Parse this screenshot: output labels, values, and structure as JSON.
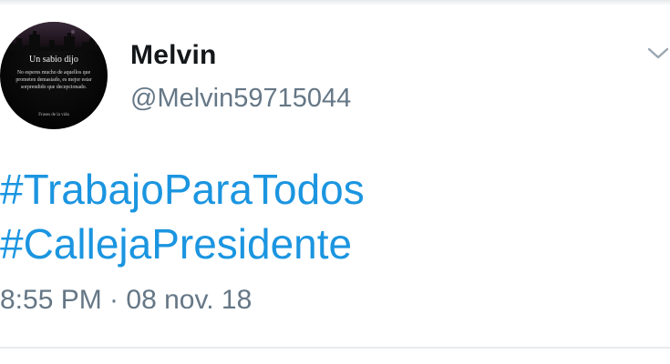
{
  "profile": {
    "display_name": "Melvin",
    "handle": "@Melvin59715044",
    "avatar": {
      "title": "Un sabio dijo",
      "quote": "No esperes mucho de aquellos que prometen demasiado, es mejor estar sorprendido que decepcionado.",
      "footer": "Frases de la vida"
    }
  },
  "tweet": {
    "hashtags": [
      "#TrabajoParaTodos",
      "#CallejaPresidente"
    ],
    "timestamp": "8:55 PM · 08 nov. 18"
  },
  "icons": {
    "more_menu": "chevron-down-icon"
  },
  "colors": {
    "hashtag": "#1b95e0",
    "secondary_text": "#657786",
    "primary_text": "#14171a"
  }
}
